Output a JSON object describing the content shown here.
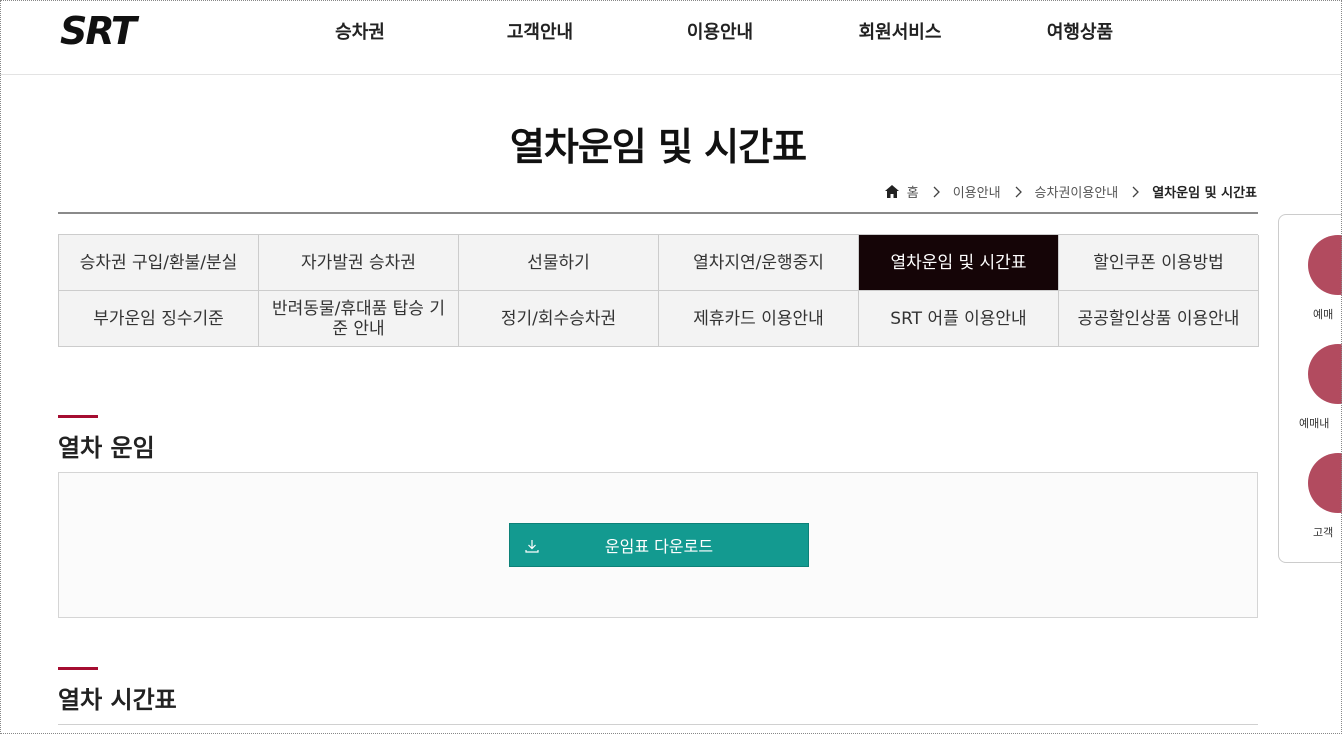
{
  "brand": {
    "logo": "SRT"
  },
  "gnb": [
    "승차권",
    "고객안내",
    "이용안내",
    "회원서비스",
    "여행상품"
  ],
  "page": {
    "title": "열차운임 및 시간표",
    "breadcrumb": [
      "홈",
      "이용안내",
      "승차권이용안내",
      "열차운임 및 시간표"
    ]
  },
  "tabs": [
    {
      "label": "승차권 구입/환불/분실",
      "active": false
    },
    {
      "label": "자가발권 승차권",
      "active": false
    },
    {
      "label": "선물하기",
      "active": false
    },
    {
      "label": "열차지연/운행중지",
      "active": false
    },
    {
      "label": "열차운임 및 시간표",
      "active": true
    },
    {
      "label": "할인쿠폰 이용방법",
      "active": false
    },
    {
      "label": "부가운임 징수기준",
      "active": false
    },
    {
      "label": "반려동물/휴대품 탑승 기준 안내",
      "active": false
    },
    {
      "label": "정기/회수승차권",
      "active": false
    },
    {
      "label": "제휴카드 이용안내",
      "active": false
    },
    {
      "label": "SRT 어플 이용안내",
      "active": false
    },
    {
      "label": "공공할인상품 이용안내",
      "active": false
    }
  ],
  "sections": {
    "fare": {
      "title": "열차 운임",
      "download_label": "운임표 다운로드"
    },
    "timetable": {
      "title": "열차 시간표"
    }
  },
  "quick_menu": [
    "예매",
    "예매내",
    "고객"
  ],
  "colors": {
    "accent": "#a50d31",
    "button": "#139a90",
    "active_tab": "#150507",
    "quick_circle": "#b24b5f"
  }
}
